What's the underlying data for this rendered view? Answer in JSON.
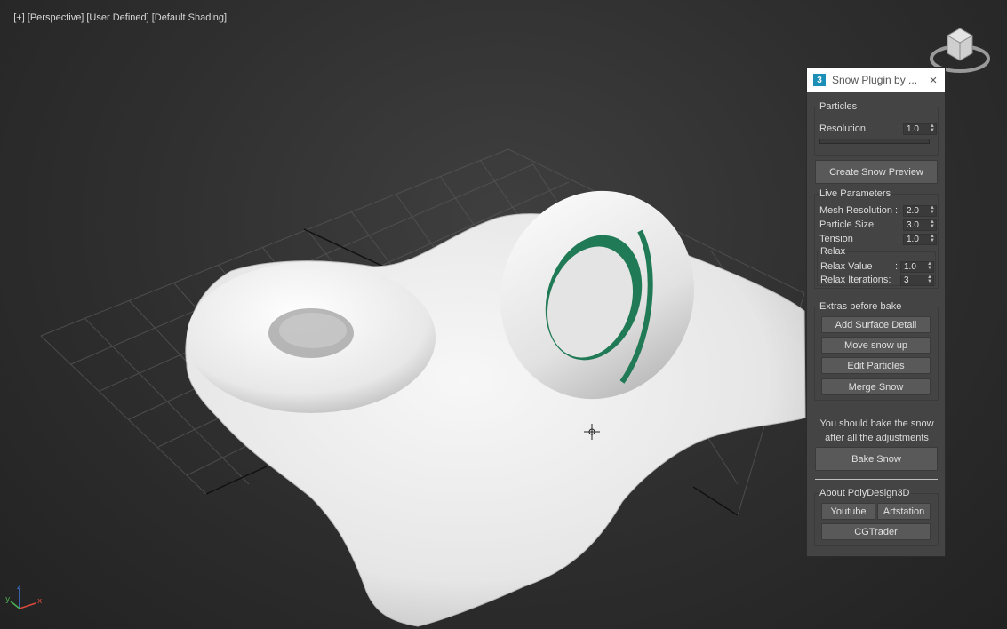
{
  "viewport": {
    "label_plus": "[+]",
    "label_view": "[Perspective]",
    "label_user": "[User Defined]",
    "label_shading": "[Default Shading]",
    "axis_x": "x",
    "axis_y": "y",
    "axis_z": "z"
  },
  "plugin": {
    "app_badge": "3",
    "title": "Snow Plugin by ...",
    "close_icon": "×",
    "particles": {
      "group_title": "Particles",
      "resolution_label": "Resolution",
      "resolution_value": "1.0",
      "progress": 0
    },
    "create_preview_label": "Create Snow Preview",
    "live": {
      "group_title": "Live Parameters",
      "mesh_resolution_label": "Mesh Resolution :",
      "mesh_resolution_value": "2.0",
      "particle_size_label": "Particle Size",
      "particle_size_value": "3.0",
      "tension_label": "Tension",
      "tension_value": "1.0",
      "relax_title": "Relax",
      "relax_value_label": "Relax Value",
      "relax_value_value": "1.0",
      "relax_iterations_label": "Relax Iterations:",
      "relax_iterations_value": "3"
    },
    "extras": {
      "group_title": "Extras before bake",
      "add_surface_detail": "Add Surface Detail",
      "move_snow_up": "Move snow up",
      "edit_particles": "Edit Particles",
      "merge_snow": "Merge Snow"
    },
    "bake": {
      "note_line1": "You should bake the snow",
      "note_line2": "after all the adjustments",
      "bake_label": "Bake Snow"
    },
    "about": {
      "group_title": "About PolyDesign3D",
      "youtube": "Youtube",
      "artstation": "Artstation",
      "cgtrader": "CGTrader"
    }
  },
  "colors": {
    "panel_bg": "#444444",
    "button_bg": "#595959",
    "badge": "#1b8fb6",
    "snow": "#f2f2f2",
    "inner_green": "#1f7a55"
  }
}
